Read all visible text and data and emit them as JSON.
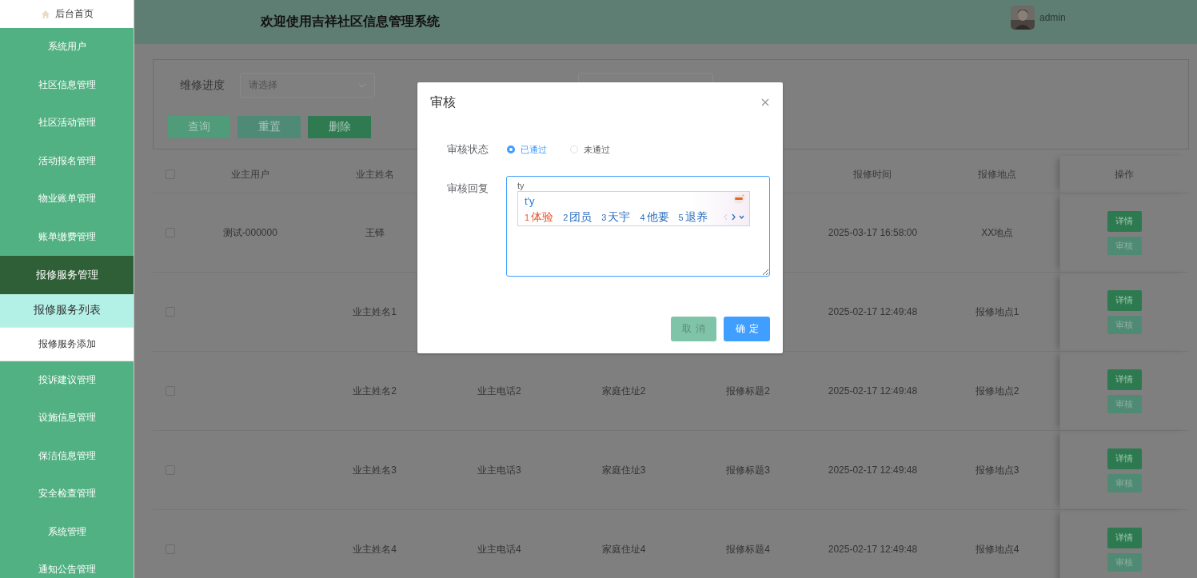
{
  "sidebar": {
    "items": [
      {
        "label": "后台首页",
        "kind": "home"
      },
      {
        "label": "系统用户",
        "kind": "group",
        "expanded": false
      },
      {
        "label": "社区信息管理",
        "kind": "group",
        "expanded": false
      },
      {
        "label": "社区活动管理",
        "kind": "group",
        "expanded": false
      },
      {
        "label": "活动报名管理",
        "kind": "group",
        "expanded": false
      },
      {
        "label": "物业账单管理",
        "kind": "group",
        "expanded": false
      },
      {
        "label": "账单缴费管理",
        "kind": "group",
        "expanded": false
      },
      {
        "label": "报修服务管理",
        "kind": "group",
        "expanded": true,
        "children": [
          {
            "label": "报修服务列表",
            "selected": true
          },
          {
            "label": "报修服务添加",
            "selected": false
          }
        ]
      },
      {
        "label": "投诉建议管理",
        "kind": "group",
        "expanded": false
      },
      {
        "label": "设施信息管理",
        "kind": "group",
        "expanded": false
      },
      {
        "label": "保洁信息管理",
        "kind": "group",
        "expanded": false
      },
      {
        "label": "安全检查管理",
        "kind": "group",
        "expanded": false
      },
      {
        "label": "系统管理",
        "kind": "group",
        "expanded": false
      },
      {
        "label": "通知公告管理",
        "kind": "group",
        "expanded": false
      }
    ]
  },
  "header": {
    "title": "欢迎使用吉祥社区信息管理系统",
    "user": "admin"
  },
  "filter": {
    "fields": [
      {
        "kind": "select",
        "label": "维修进度",
        "placeholder": "请选择"
      },
      {
        "kind": "select"
      }
    ],
    "buttons": [
      {
        "label": "查询",
        "kind": "query"
      },
      {
        "label": "重置",
        "kind": "reset"
      },
      {
        "label": "删除",
        "kind": "delete"
      }
    ]
  },
  "table": {
    "select_all_checked": false,
    "columns": [
      "业主用户",
      "业主姓名",
      null,
      null,
      null,
      "报修时间",
      "报修地点"
    ],
    "action_column": "操作",
    "rows": [
      {
        "checked": false,
        "cells": [
          "测试-000000",
          "王铎",
          null,
          null,
          null,
          "2025-03-17 16:58:00",
          "XX地点"
        ],
        "actions": [
          {
            "label": "详情",
            "kind": "detail"
          },
          {
            "label": "审核",
            "kind": "audit"
          }
        ]
      },
      {
        "checked": false,
        "cells": [
          null,
          "业主姓名1",
          null,
          null,
          null,
          "2025-02-17 12:49:48",
          "报修地点1"
        ],
        "actions": [
          {
            "label": "详情",
            "kind": "detail"
          },
          {
            "label": "审核",
            "kind": "audit"
          }
        ]
      },
      {
        "checked": false,
        "cells": [
          null,
          "业主姓名2",
          "业主电话2",
          "家庭住址2",
          "报修标题2",
          "2025-02-17 12:49:48",
          "报修地点2"
        ],
        "actions": [
          {
            "label": "详情",
            "kind": "detail"
          },
          {
            "label": "审核",
            "kind": "audit"
          }
        ]
      },
      {
        "checked": false,
        "cells": [
          null,
          "业主姓名3",
          "业主电话3",
          "家庭住址3",
          "报修标题3",
          "2025-02-17 12:49:48",
          "报修地点3"
        ],
        "actions": [
          {
            "label": "详情",
            "kind": "detail"
          },
          {
            "label": "审核",
            "kind": "audit"
          }
        ]
      },
      {
        "checked": false,
        "cells": [
          null,
          "业主姓名4",
          "业主电话4",
          "家庭住址4",
          "报修标题4",
          "2025-02-17 12:49:48",
          "报修地点4"
        ],
        "actions": [
          {
            "label": "详情",
            "kind": "detail"
          },
          {
            "label": "审核",
            "kind": "audit"
          }
        ]
      }
    ]
  },
  "dialog": {
    "title": "审核",
    "fields": [
      {
        "kind": "radio",
        "label": "审核状态",
        "options": [
          {
            "label": "已通过",
            "selected": true
          },
          {
            "label": "未通过",
            "selected": false
          }
        ]
      },
      {
        "kind": "textarea",
        "label": "审核回复",
        "value": "ty"
      }
    ],
    "buttons": [
      {
        "label": "取消",
        "kind": "cancel"
      },
      {
        "label": "确定",
        "kind": "confirm"
      }
    ]
  },
  "ime": {
    "composition": "t'y",
    "candidates": [
      {
        "index": "1",
        "text": "体验",
        "selected": true
      },
      {
        "index": "2",
        "text": "团员",
        "selected": false
      },
      {
        "index": "3",
        "text": "天宇",
        "selected": false
      },
      {
        "index": "4",
        "text": "他要",
        "selected": false
      },
      {
        "index": "5",
        "text": "退养",
        "selected": false
      }
    ]
  }
}
